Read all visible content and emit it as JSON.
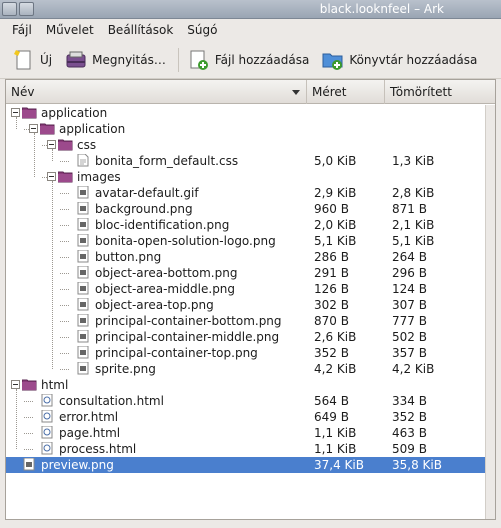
{
  "window": {
    "title": "black.looknfeel – Ark"
  },
  "menu": [
    "Fájl",
    "Művelet",
    "Beállítások",
    "Súgó"
  ],
  "toolbar": {
    "new": "Új",
    "open": "Megnyitás…",
    "add_file": "Fájl hozzáadása",
    "add_dir": "Könyvtár hozzáadása"
  },
  "columns": {
    "name": "Név",
    "size": "Méret",
    "compressed": "Tömörített"
  },
  "rows": [
    {
      "name": "application",
      "size": "",
      "packed": "",
      "type": "folder",
      "depth": 0
    },
    {
      "name": "application",
      "size": "",
      "packed": "",
      "type": "folder",
      "depth": 1
    },
    {
      "name": "css",
      "size": "",
      "packed": "",
      "type": "folder",
      "depth": 2
    },
    {
      "name": "bonita_form_default.css",
      "size": "5,0 KiB",
      "packed": "1,3 KiB",
      "type": "file",
      "depth": 3
    },
    {
      "name": "images",
      "size": "",
      "packed": "",
      "type": "folder",
      "depth": 2
    },
    {
      "name": "avatar-default.gif",
      "size": "2,9 KiB",
      "packed": "2,8 KiB",
      "type": "image",
      "depth": 3
    },
    {
      "name": "background.png",
      "size": "960 B",
      "packed": "871 B",
      "type": "image",
      "depth": 3
    },
    {
      "name": "bloc-identification.png",
      "size": "2,0 KiB",
      "packed": "2,1 KiB",
      "type": "image",
      "depth": 3
    },
    {
      "name": "bonita-open-solution-logo.png",
      "size": "5,1 KiB",
      "packed": "5,1 KiB",
      "type": "image",
      "depth": 3
    },
    {
      "name": "button.png",
      "size": "286 B",
      "packed": "264 B",
      "type": "image",
      "depth": 3
    },
    {
      "name": "object-area-bottom.png",
      "size": "291 B",
      "packed": "296 B",
      "type": "image",
      "depth": 3
    },
    {
      "name": "object-area-middle.png",
      "size": "126 B",
      "packed": "124 B",
      "type": "image",
      "depth": 3
    },
    {
      "name": "object-area-top.png",
      "size": "302 B",
      "packed": "307 B",
      "type": "image",
      "depth": 3
    },
    {
      "name": "principal-container-bottom.png",
      "size": "870 B",
      "packed": "777 B",
      "type": "image",
      "depth": 3
    },
    {
      "name": "principal-container-middle.png",
      "size": "2,6 KiB",
      "packed": "502 B",
      "type": "image",
      "depth": 3
    },
    {
      "name": "principal-container-top.png",
      "size": "352 B",
      "packed": "357 B",
      "type": "image",
      "depth": 3
    },
    {
      "name": "sprite.png",
      "size": "4,2 KiB",
      "packed": "4,2 KiB",
      "type": "image",
      "depth": 3
    },
    {
      "name": "html",
      "size": "",
      "packed": "",
      "type": "folder",
      "depth": 0
    },
    {
      "name": "consultation.html",
      "size": "564 B",
      "packed": "334 B",
      "type": "html",
      "depth": 1
    },
    {
      "name": "error.html",
      "size": "649 B",
      "packed": "352 B",
      "type": "html",
      "depth": 1
    },
    {
      "name": "page.html",
      "size": "1,1 KiB",
      "packed": "463 B",
      "type": "html",
      "depth": 1
    },
    {
      "name": "process.html",
      "size": "1,1 KiB",
      "packed": "509 B",
      "type": "html",
      "depth": 1
    },
    {
      "name": "preview.png",
      "size": "37,4 KiB",
      "packed": "35,8 KiB",
      "type": "image",
      "depth": 0,
      "selected": true
    }
  ],
  "colors": {
    "selection": "#4a7fce",
    "folder": "#8a3a7a",
    "titlebar": "#9aa5b3"
  }
}
